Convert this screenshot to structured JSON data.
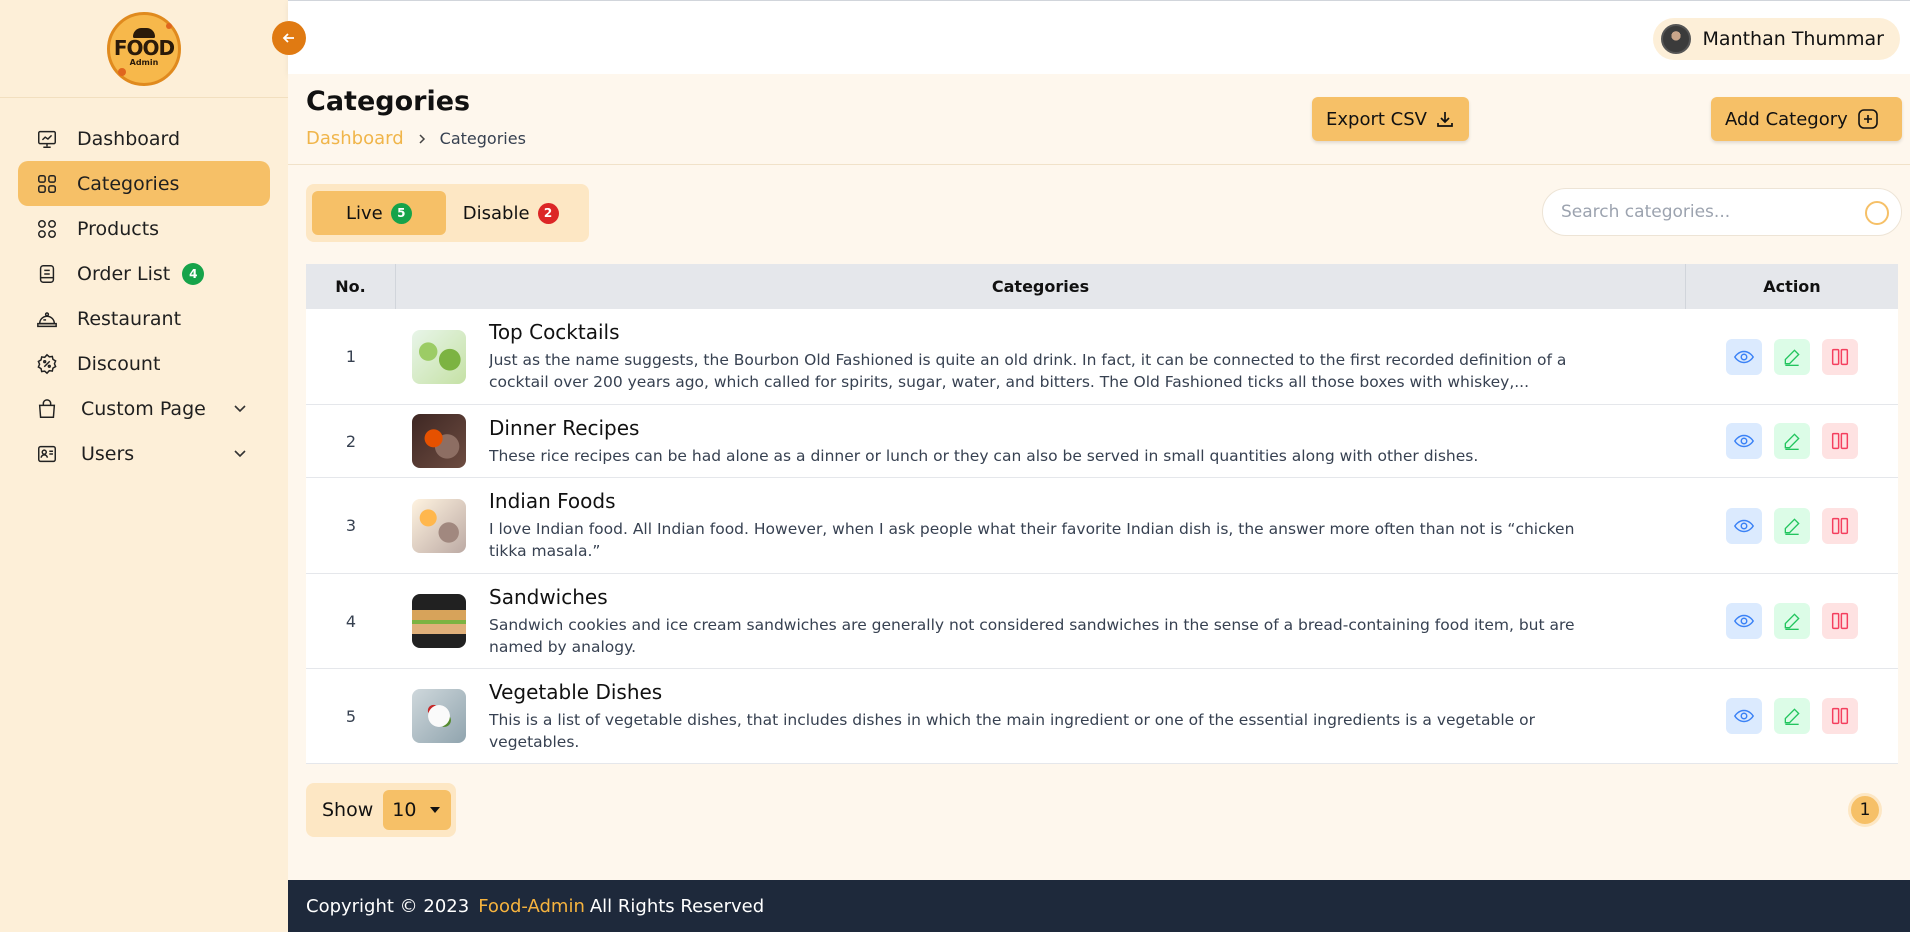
{
  "logo": {
    "word": "FOOD",
    "sub": "Admin"
  },
  "sidebar": {
    "items": [
      {
        "label": "Dashboard",
        "icon": "dashboard-icon"
      },
      {
        "label": "Categories",
        "icon": "grid-icon",
        "active": true
      },
      {
        "label": "Products",
        "icon": "grid-icon"
      },
      {
        "label": "Order List",
        "icon": "order-icon",
        "badge": "4"
      },
      {
        "label": "Restaurant",
        "icon": "cloche-icon"
      },
      {
        "label": "Discount",
        "icon": "discount-icon"
      },
      {
        "label": "Custom Page",
        "icon": "bag-icon",
        "expandable": true
      },
      {
        "label": "Users",
        "icon": "user-card-icon",
        "expandable": true
      }
    ]
  },
  "header": {
    "user_name": "Manthan Thummar"
  },
  "page": {
    "title": "Categories",
    "breadcrumb": {
      "link": "Dashboard",
      "current": "Categories"
    },
    "export_label": "Export CSV",
    "add_label": "Add Category"
  },
  "tabs": [
    {
      "label": "Live",
      "count": "5",
      "color": "#16a34a",
      "active": true
    },
    {
      "label": "Disable",
      "count": "2",
      "color": "#dc2626"
    }
  ],
  "search": {
    "placeholder": "Search categories...",
    "value": ""
  },
  "table": {
    "headers": {
      "no": "No.",
      "categories": "Categories",
      "action": "Action"
    },
    "rows": [
      {
        "no": "1",
        "name": "Top Cocktails",
        "desc": "Just as the name suggests, the Bourbon Old Fashioned is quite an old drink. In fact, it can be connected to the first recorded definition of a cocktail over 200 years ago, which called for spirits, sugar, water, and bitters. The Old Fashioned ticks all those boxes with whiskey,..."
      },
      {
        "no": "2",
        "name": "Dinner Recipes",
        "desc": "These rice recipes can be had alone as a dinner or lunch or they can also be served in small quantities along with other dishes."
      },
      {
        "no": "3",
        "name": "Indian Foods",
        "desc": "I love Indian food. All Indian food. However, when I ask people what their favorite Indian dish is, the answer more often than not is “chicken tikka masala.”"
      },
      {
        "no": "4",
        "name": "Sandwiches",
        "desc": "Sandwich cookies and ice cream sandwiches are generally not considered sandwiches in the sense of a bread-containing food item, but are named by analogy."
      },
      {
        "no": "5",
        "name": "Vegetable Dishes",
        "desc": "This is a list of vegetable dishes, that includes dishes in which the main ingredient or one of the essential ingredients is a vegetable or vegetables."
      }
    ]
  },
  "pagination": {
    "show_label": "Show",
    "page_size": "10",
    "current_page": "1"
  },
  "footer": {
    "prefix": "Copyright © 2023",
    "brand": "Food-Admin",
    "suffix": "All Rights Reserved"
  },
  "colors": {
    "accent": "#f6c067",
    "sidebar_bg": "#fdefd8",
    "main_bg": "#fef7ed",
    "footer_bg": "#1e293b"
  }
}
